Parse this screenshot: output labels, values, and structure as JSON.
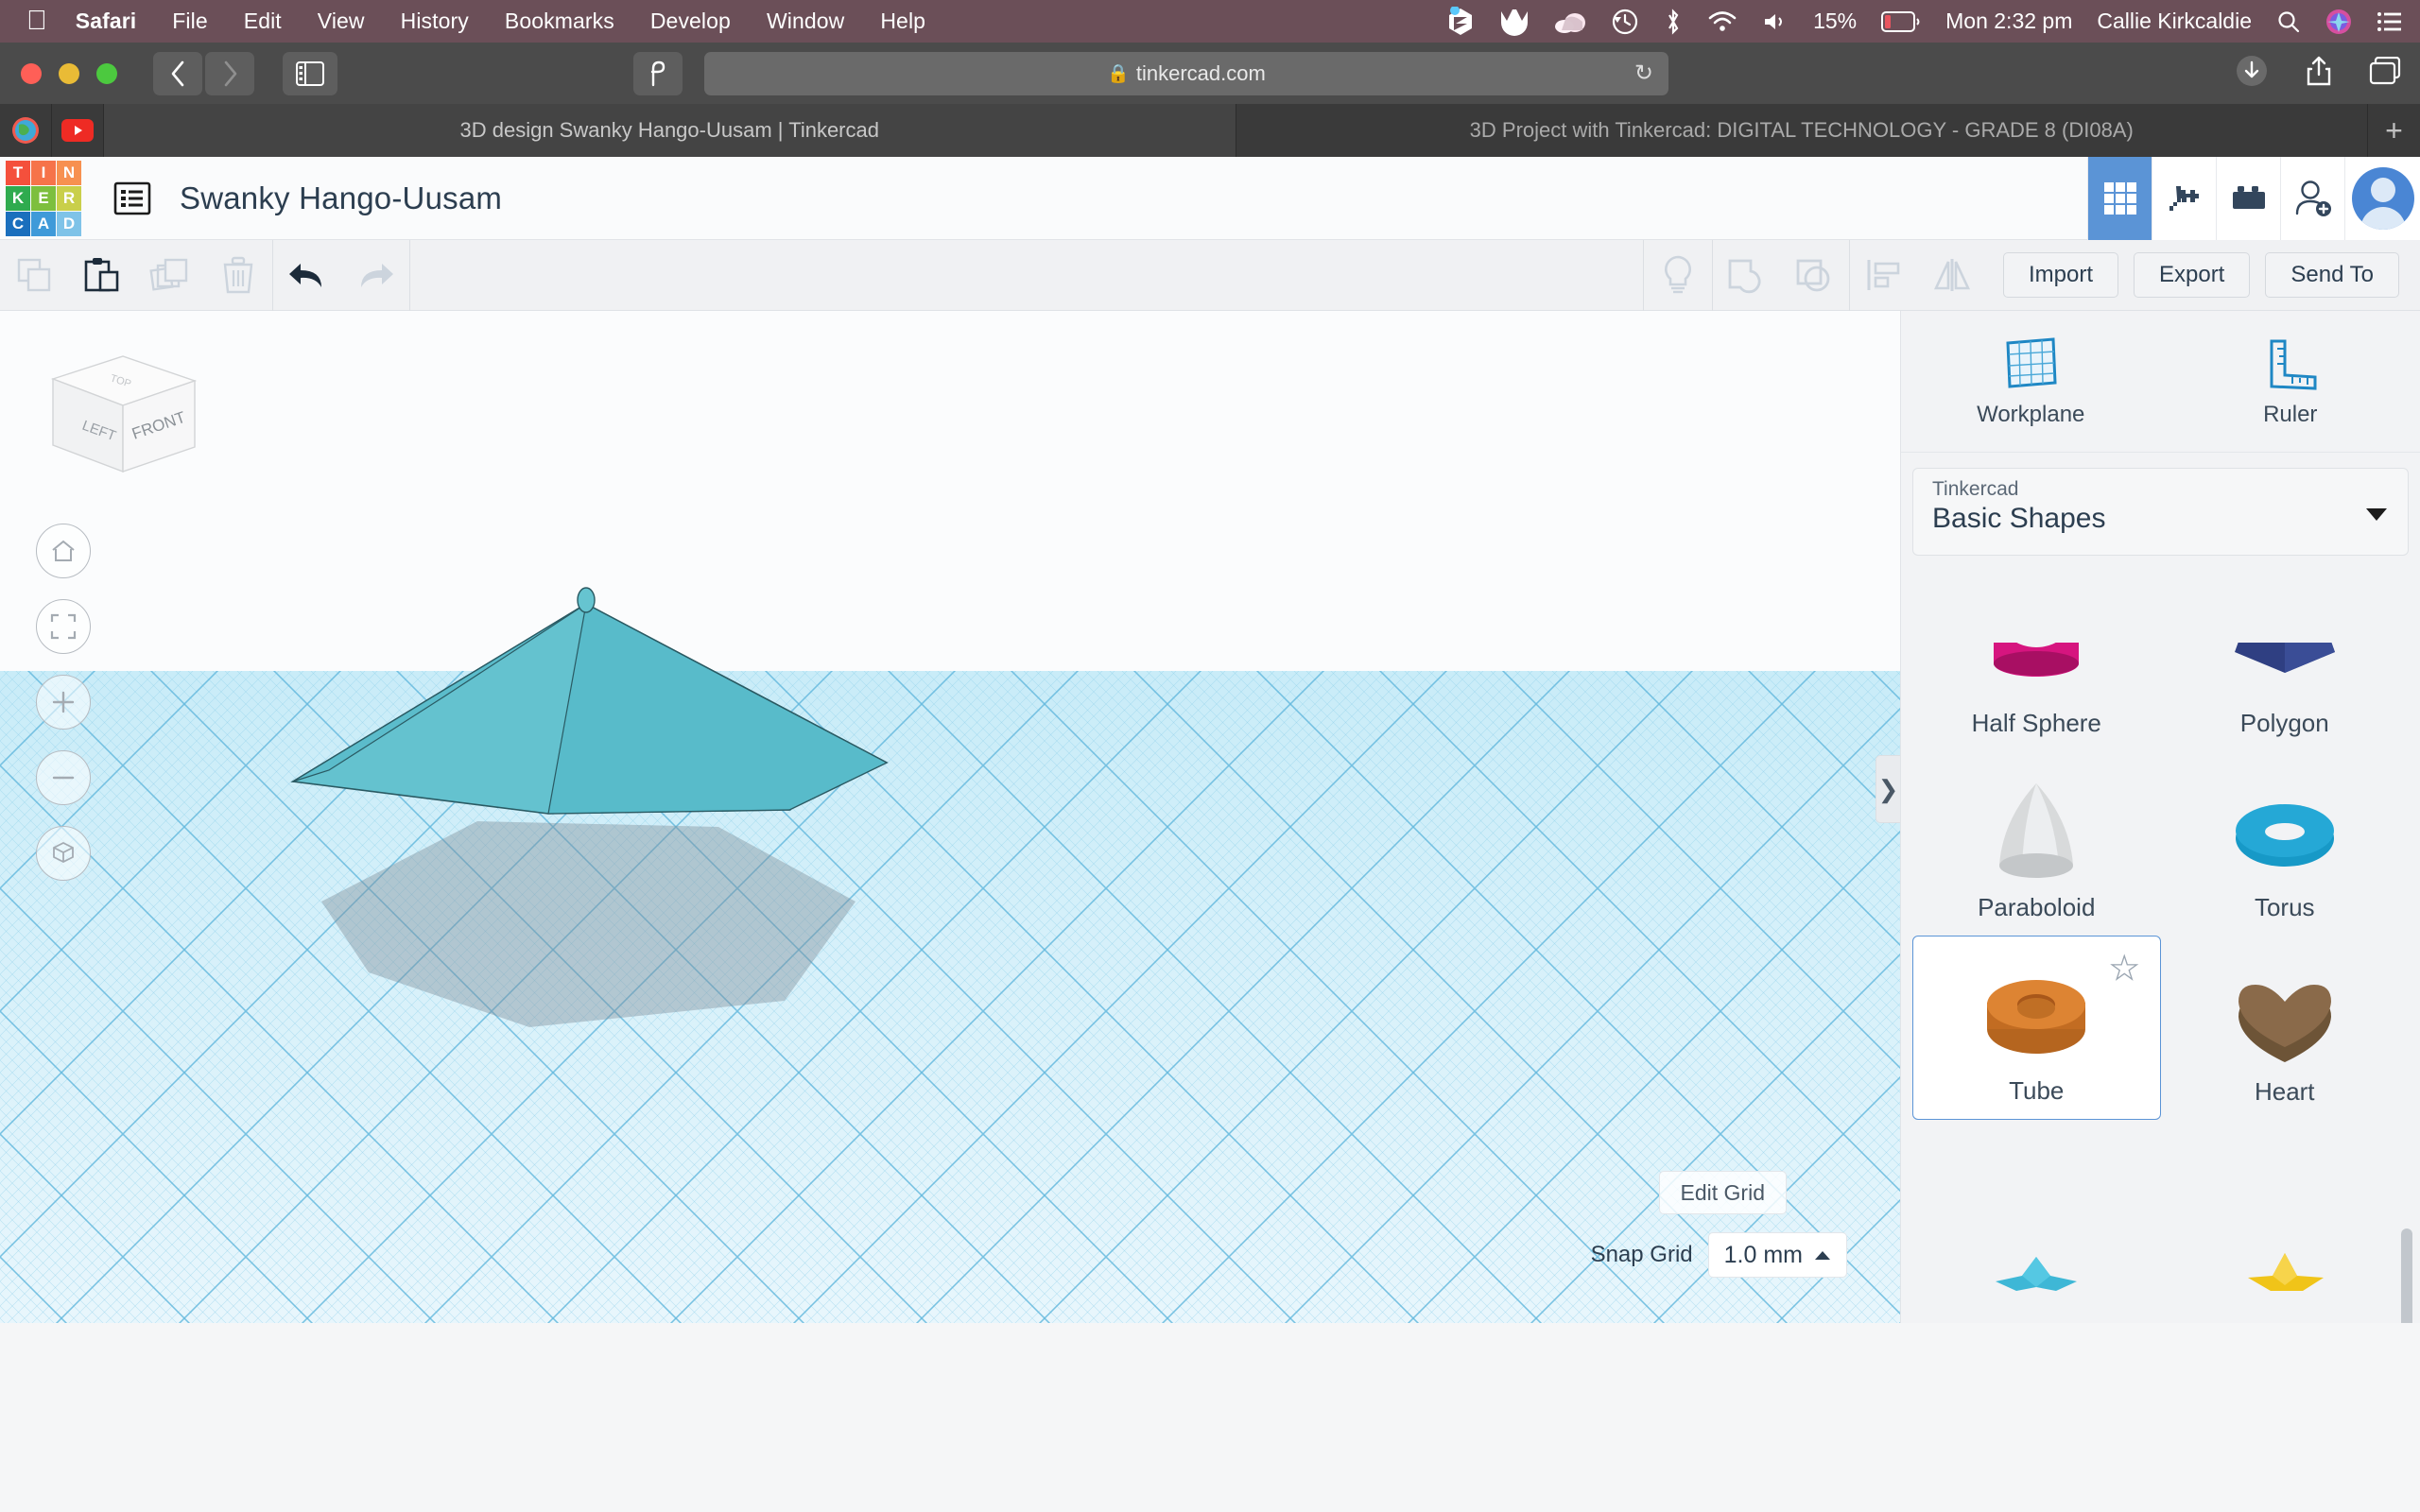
{
  "menubar": {
    "apple_icon": "apple-icon",
    "items": [
      {
        "label": "Safari",
        "bold": true
      },
      {
        "label": "File",
        "bold": false
      },
      {
        "label": "Edit",
        "bold": false
      },
      {
        "label": "View",
        "bold": false
      },
      {
        "label": "History",
        "bold": false
      },
      {
        "label": "Bookmarks",
        "bold": false
      },
      {
        "label": "Develop",
        "bold": false
      },
      {
        "label": "Window",
        "bold": false
      },
      {
        "label": "Help",
        "bold": false
      }
    ],
    "status": {
      "battery_percent": "15%",
      "battery_color": "#e8555f",
      "datetime": "Mon 2:32 pm",
      "user": "Callie Kirkcaldie",
      "icons": [
        "sketch-icon",
        "malwarebytes-icon",
        "cloud-icon",
        "time-machine-icon",
        "bluetooth-icon",
        "wifi-icon",
        "volume-icon",
        "battery-icon",
        "search-icon",
        "siri-icon",
        "control-center-icon"
      ]
    }
  },
  "browser": {
    "url": "tinkercad.com",
    "lock_icon": "lock-icon",
    "reload_icon": "reload-icon",
    "back_icon": "chevron-left-icon",
    "forward_icon": "chevron-right-icon",
    "sidebar_icon": "sidebar-icon",
    "reader_icon": "reader-icon",
    "download_icon": "download-icon",
    "share_icon": "share-icon",
    "tabs_overview_icon": "tab-overview-icon",
    "newtab_label": "+",
    "tabs": [
      {
        "title": "3D design Swanky Hango-Uusam | Tinkercad",
        "active": true
      },
      {
        "title": "3D Project with Tinkercad: DIGITAL TECHNOLOGY - GRADE 8 (DI08A)",
        "active": false
      }
    ],
    "favorites": [
      "globe-favicon",
      "youtube-favicon"
    ]
  },
  "tinkercad": {
    "logo_tiles": [
      {
        "ch": "T",
        "color": "#f4503c"
      },
      {
        "ch": "I",
        "color": "#f6734a"
      },
      {
        "ch": "N",
        "color": "#f79050"
      },
      {
        "ch": "K",
        "color": "#2fab4f"
      },
      {
        "ch": "E",
        "color": "#7dbf3e"
      },
      {
        "ch": "R",
        "color": "#c9cf4a"
      },
      {
        "ch": "C",
        "color": "#1a6fbd"
      },
      {
        "ch": "A",
        "color": "#3f9ad9"
      },
      {
        "ch": "D",
        "color": "#7fc3e8"
      }
    ],
    "design_title": "Swanky Hango-Uusam",
    "doclist_icon": "document-list-icon",
    "header_buttons": [
      {
        "name": "grid-view",
        "icon": "grid-icon",
        "active": true
      },
      {
        "name": "minecraft",
        "icon": "pickaxe-icon",
        "active": false
      },
      {
        "name": "blocks",
        "icon": "lego-brick-icon",
        "active": false
      },
      {
        "name": "invite",
        "icon": "person-add-icon",
        "active": false
      }
    ],
    "avatar": "user-avatar",
    "edit_toolbar": {
      "left_icons": [
        {
          "name": "copy-icon",
          "enabled": false
        },
        {
          "name": "paste-icon",
          "enabled": true
        },
        {
          "name": "duplicate-icon",
          "enabled": false
        },
        {
          "name": "delete-icon",
          "enabled": false
        }
      ],
      "history_icons": [
        {
          "name": "undo-icon",
          "enabled": true
        },
        {
          "name": "redo-icon",
          "enabled": false
        }
      ],
      "right_icons": [
        {
          "name": "lightbulb-icon",
          "enabled": false
        },
        {
          "name": "group-icon",
          "enabled": false
        },
        {
          "name": "ungroup-icon",
          "enabled": false
        },
        {
          "name": "align-icon",
          "enabled": false
        },
        {
          "name": "mirror-icon",
          "enabled": false
        }
      ],
      "actions": [
        {
          "label": "Import"
        },
        {
          "label": "Export"
        },
        {
          "label": "Send To"
        }
      ]
    },
    "canvas": {
      "view_cube_faces": {
        "left": "LEFT",
        "front": "FRONT",
        "top": "TOP"
      },
      "nav_buttons": [
        {
          "name": "home-view-icon"
        },
        {
          "name": "fit-to-view-icon"
        },
        {
          "name": "zoom-in-icon"
        },
        {
          "name": "zoom-out-icon"
        },
        {
          "name": "ortho-perspective-icon"
        }
      ],
      "object_color": "#5fbecd",
      "edit_grid_label": "Edit Grid",
      "snap_grid_label": "Snap Grid",
      "snap_grid_value": "1.0 mm",
      "panel_handle_icon": "chevron-right-icon"
    },
    "panel": {
      "tools": [
        {
          "label": "Workplane",
          "icon": "workplane-icon"
        },
        {
          "label": "Ruler",
          "icon": "ruler-icon"
        }
      ],
      "category_label": "Tinkercad",
      "category_value": "Basic Shapes",
      "dropdown_icon": "caret-down-icon",
      "shapes": [
        {
          "label": "Half Sphere",
          "color": "#d6157f",
          "kind": "halfsphere",
          "selected": false,
          "partial": true
        },
        {
          "label": "Polygon",
          "color": "#2f3f82",
          "kind": "polygon",
          "selected": false,
          "partial": true
        },
        {
          "label": "Paraboloid",
          "color": "#c9cbcc",
          "kind": "paraboloid",
          "selected": false,
          "partial": false
        },
        {
          "label": "Torus",
          "color": "#1799c7",
          "kind": "torus",
          "selected": false,
          "partial": false
        },
        {
          "label": "Tube",
          "color": "#d97a2b",
          "kind": "tube",
          "selected": true,
          "partial": false
        },
        {
          "label": "Heart",
          "color": "#8a6a4a",
          "kind": "heart",
          "selected": false,
          "partial": false
        },
        {
          "label": "",
          "color": "#3eb7d6",
          "kind": "star3d",
          "selected": false,
          "partial": true
        },
        {
          "label": "",
          "color": "#f0c419",
          "kind": "star",
          "selected": false,
          "partial": true
        }
      ],
      "favorite_star_icon": "star-outline-icon"
    }
  }
}
